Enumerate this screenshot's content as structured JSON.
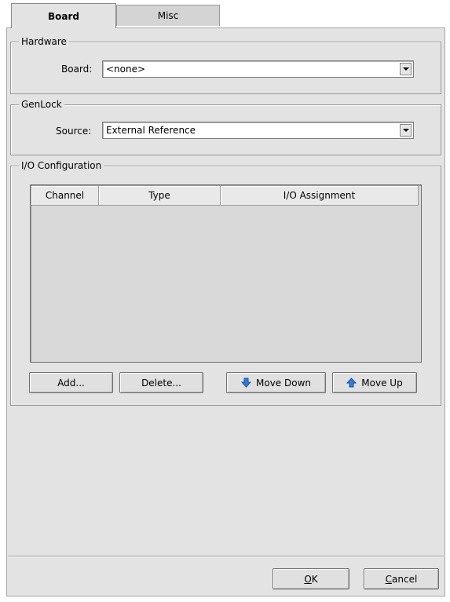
{
  "tabs": [
    {
      "label": "Board",
      "active": true
    },
    {
      "label": "Misc",
      "active": false
    }
  ],
  "hardware": {
    "group_label": "Hardware",
    "board_label": "Board:",
    "board_value": "<none>"
  },
  "genlock": {
    "group_label": "GenLock",
    "source_label": "Source:",
    "source_value": "External Reference"
  },
  "io": {
    "group_label": "I/O Configuration",
    "columns": [
      "Channel",
      "Type",
      "I/O Assignment"
    ],
    "rows": [],
    "buttons": {
      "add": "Add...",
      "delete": "Delete...",
      "move_down": "Move Down",
      "move_up": "Move Up"
    }
  },
  "footer": {
    "ok_mnemonic": "O",
    "ok_rest": "K",
    "cancel_mnemonic": "C",
    "cancel_rest": "ancel"
  },
  "colors": {
    "panel_bg": "#e3e3e3",
    "arrow_icon": "#2a7fe0"
  },
  "icons": {
    "move_down": "arrow-down-icon",
    "move_up": "arrow-up-icon",
    "dropdown": "chevron-down-icon"
  }
}
